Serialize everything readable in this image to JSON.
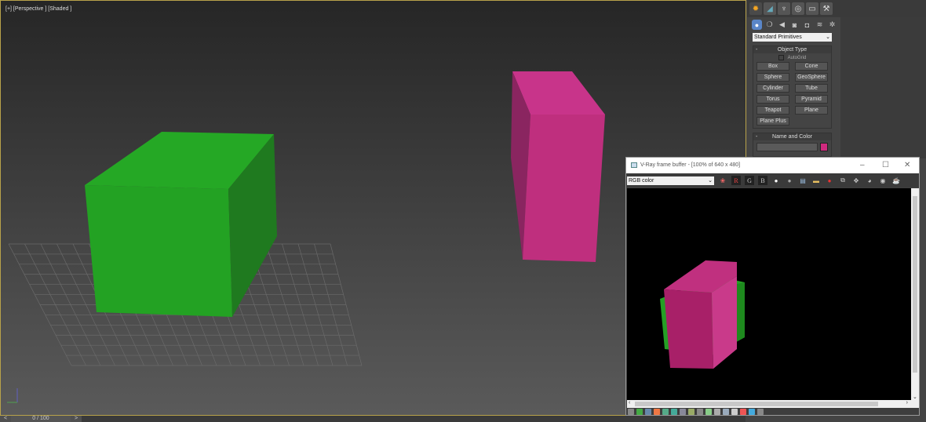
{
  "viewport": {
    "label": "[+] [Perspective ] [Shaded ]",
    "colors": {
      "green": "#22a022",
      "magenta": "#c0307f"
    }
  },
  "timeline": {
    "prev": "<",
    "value": "0 / 100",
    "next": ">"
  },
  "command_panel": {
    "tabs": [
      "create-icon",
      "modify-icon",
      "hierarchy-icon",
      "motion-icon",
      "display-icon",
      "utilities-icon"
    ],
    "subtabs": [
      "geometry-icon",
      "shapes-icon",
      "lights-icon",
      "cameras-icon",
      "helpers-icon",
      "spacewarps-icon",
      "systems-icon"
    ],
    "category": "Standard Primitives",
    "object_type": {
      "title": "Object Type",
      "autogrid": "AutoGrid",
      "buttons": [
        "Box",
        "Cone",
        "Sphere",
        "GeoSphere",
        "Cylinder",
        "Tube",
        "Torus",
        "Pyramid",
        "Teapot",
        "Plane",
        "Plane Plus"
      ]
    },
    "name_color": {
      "title": "Name and Color",
      "name": "",
      "color": "#d02a7e"
    }
  },
  "vfb": {
    "title": "V-Ray frame buffer - [100% of 640 x 480]",
    "channel": "RGB color",
    "r": "R",
    "g": "G",
    "b": "B"
  }
}
